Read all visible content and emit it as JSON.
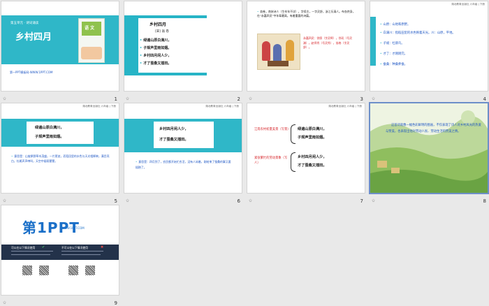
{
  "header": "湖北教育出版社 六年级 | 下册",
  "slides": [
    {
      "num": "1",
      "tag": "第五单元 · 诗词诵读",
      "title": "乡村四月",
      "book_label": "语 文",
      "url": "第一PPT模板网-WWW.1PPT.COM"
    },
    {
      "num": "2",
      "title": "乡村四月",
      "author": "[宋]  翁 卷",
      "lines": [
        "绿遍山原白满川，",
        "子规声里雨如烟。",
        "乡村四月闲人少，",
        "才了蚕桑又插田。"
      ]
    },
    {
      "num": "3",
      "intro": "翁卷，南宋诗人（生卒年不详），字续古，一字灵舒，浙江乐清人。布衣终身，在“永嘉四灵”中年辈最高，有着重要的诗篇。",
      "side": "永嘉四灵：徐照（字灵晖），徐玑（号灵渊），赵师秀（号灵秀），翁卷（字灵舒）。"
    },
    {
      "num": "4",
      "items": [
        "山原：山地和原野。",
        "白满川：指稻田里的水色映着天光。川：山原，平地。",
        "子规：杜鹃鸟。",
        "才了：才刚刚完。",
        "蚕桑：种桑养蚕。"
      ]
    },
    {
      "num": "5",
      "lines": [
        "绿遍山原白满川，",
        "子规声里雨如烟。"
      ],
      "meaning": "意思是：山坡原野草木茂盛，一片葱茏，而稻田里的水色与天光相辉映，满目亮白，杜鹃声声啼叫，天空中烟雨蒙蒙。"
    },
    {
      "num": "6",
      "lines": [
        "乡村四月闲人少，",
        "才了蚕桑又插田。"
      ],
      "meaning": "意思是：四月到了，农民都开始忙农活，没有人闲着，刚结束了蚕桑的事又要插秧了。"
    },
    {
      "num": "7",
      "label1": "江南农村初夏美景（写景）",
      "label2": "紧张繁忙的劳动景象（写人）",
      "lines1": [
        "绿遍山原白满川，",
        "子规声里雨如烟。"
      ],
      "lines2": [
        "乡村四月闲人少，",
        "才了蚕桑又插田。"
      ]
    },
    {
      "num": "8",
      "text": "这首诗就像一幅色彩鲜明的图画，不仅表现了诗人对乡村风光的热爱与赞美，也表现出他对劳动人民、劳动生活的赞美之情。"
    },
    {
      "num": "9",
      "logo": "第1PPT",
      "logo_sub": "WWW.1PPT.COM",
      "col1": "可以在以下情况使用",
      "col2": "不可以在以下情况使用"
    }
  ],
  "colors": {
    "accent": "#2fb7c8",
    "blue": "#1f57c4",
    "red": "#d6262b"
  }
}
